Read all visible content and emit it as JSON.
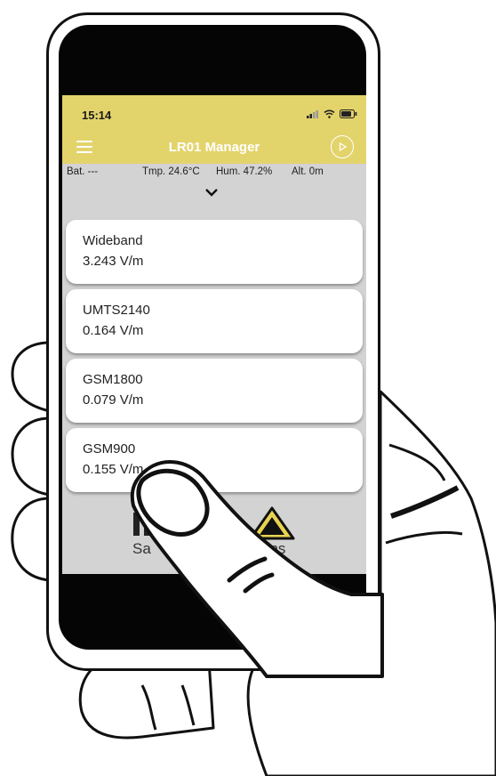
{
  "status_bar": {
    "time": "15:14"
  },
  "header": {
    "title": "LR01 Manager"
  },
  "sensors": {
    "battery": "Bat. ---",
    "temperature": "Tmp. 24.6°C",
    "humidity": "Hum. 47.2%",
    "altitude": "Alt. 0m"
  },
  "measurements": [
    {
      "band": "Wideband",
      "value": "3.243 V/m"
    },
    {
      "band": "UMTS2140",
      "value": "0.164 V/m"
    },
    {
      "band": "GSM1800",
      "value": "0.079 V/m"
    },
    {
      "band": "GSM900",
      "value": "0.155 V/m"
    }
  ],
  "bottom_nav": {
    "left_label": "Sa",
    "right_label": "ons"
  },
  "colors": {
    "header": "#e3d36b",
    "screen_bg": "#d3d3d3",
    "warning": "#e8d350"
  }
}
